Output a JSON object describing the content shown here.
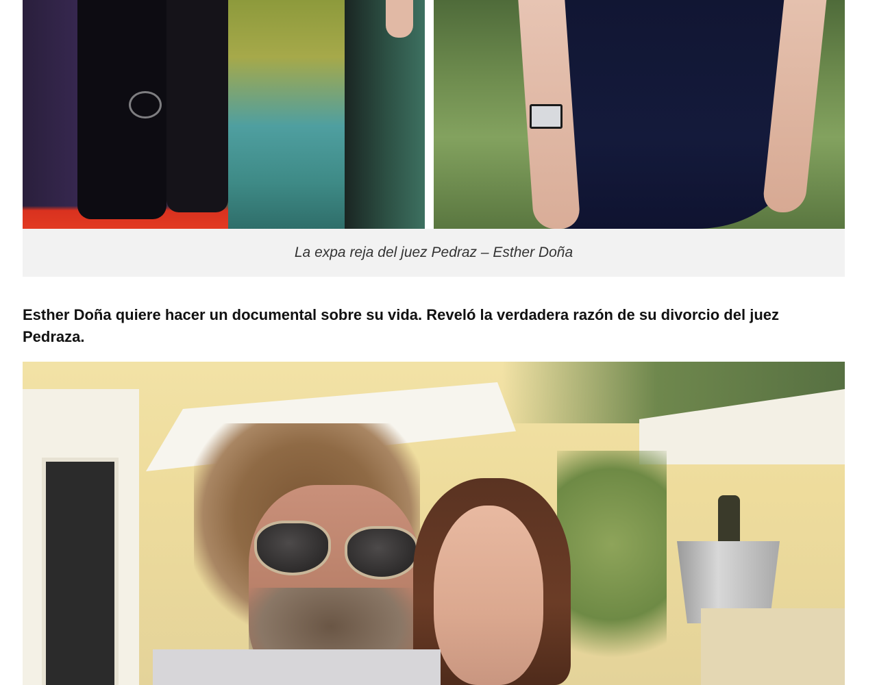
{
  "gallery": {
    "caption": "La expa reja del juez Pedraz – Esther Doña"
  },
  "article": {
    "lead": "Esther Doña quiere hacer un documental sobre su vida. Reveló la verdadera razón de su divorcio del juez Pedraza."
  }
}
